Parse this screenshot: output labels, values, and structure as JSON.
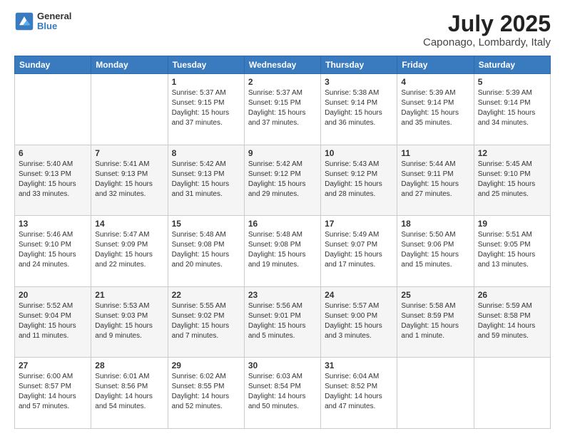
{
  "header": {
    "logo": {
      "line1": "General",
      "line2": "Blue"
    },
    "title": "July 2025",
    "subtitle": "Caponago, Lombardy, Italy"
  },
  "days_of_week": [
    "Sunday",
    "Monday",
    "Tuesday",
    "Wednesday",
    "Thursday",
    "Friday",
    "Saturday"
  ],
  "weeks": [
    [
      {
        "day": "",
        "content": ""
      },
      {
        "day": "",
        "content": ""
      },
      {
        "day": "1",
        "content": "Sunrise: 5:37 AM\nSunset: 9:15 PM\nDaylight: 15 hours\nand 37 minutes."
      },
      {
        "day": "2",
        "content": "Sunrise: 5:37 AM\nSunset: 9:15 PM\nDaylight: 15 hours\nand 37 minutes."
      },
      {
        "day": "3",
        "content": "Sunrise: 5:38 AM\nSunset: 9:14 PM\nDaylight: 15 hours\nand 36 minutes."
      },
      {
        "day": "4",
        "content": "Sunrise: 5:39 AM\nSunset: 9:14 PM\nDaylight: 15 hours\nand 35 minutes."
      },
      {
        "day": "5",
        "content": "Sunrise: 5:39 AM\nSunset: 9:14 PM\nDaylight: 15 hours\nand 34 minutes."
      }
    ],
    [
      {
        "day": "6",
        "content": "Sunrise: 5:40 AM\nSunset: 9:13 PM\nDaylight: 15 hours\nand 33 minutes."
      },
      {
        "day": "7",
        "content": "Sunrise: 5:41 AM\nSunset: 9:13 PM\nDaylight: 15 hours\nand 32 minutes."
      },
      {
        "day": "8",
        "content": "Sunrise: 5:42 AM\nSunset: 9:13 PM\nDaylight: 15 hours\nand 31 minutes."
      },
      {
        "day": "9",
        "content": "Sunrise: 5:42 AM\nSunset: 9:12 PM\nDaylight: 15 hours\nand 29 minutes."
      },
      {
        "day": "10",
        "content": "Sunrise: 5:43 AM\nSunset: 9:12 PM\nDaylight: 15 hours\nand 28 minutes."
      },
      {
        "day": "11",
        "content": "Sunrise: 5:44 AM\nSunset: 9:11 PM\nDaylight: 15 hours\nand 27 minutes."
      },
      {
        "day": "12",
        "content": "Sunrise: 5:45 AM\nSunset: 9:10 PM\nDaylight: 15 hours\nand 25 minutes."
      }
    ],
    [
      {
        "day": "13",
        "content": "Sunrise: 5:46 AM\nSunset: 9:10 PM\nDaylight: 15 hours\nand 24 minutes."
      },
      {
        "day": "14",
        "content": "Sunrise: 5:47 AM\nSunset: 9:09 PM\nDaylight: 15 hours\nand 22 minutes."
      },
      {
        "day": "15",
        "content": "Sunrise: 5:48 AM\nSunset: 9:08 PM\nDaylight: 15 hours\nand 20 minutes."
      },
      {
        "day": "16",
        "content": "Sunrise: 5:48 AM\nSunset: 9:08 PM\nDaylight: 15 hours\nand 19 minutes."
      },
      {
        "day": "17",
        "content": "Sunrise: 5:49 AM\nSunset: 9:07 PM\nDaylight: 15 hours\nand 17 minutes."
      },
      {
        "day": "18",
        "content": "Sunrise: 5:50 AM\nSunset: 9:06 PM\nDaylight: 15 hours\nand 15 minutes."
      },
      {
        "day": "19",
        "content": "Sunrise: 5:51 AM\nSunset: 9:05 PM\nDaylight: 15 hours\nand 13 minutes."
      }
    ],
    [
      {
        "day": "20",
        "content": "Sunrise: 5:52 AM\nSunset: 9:04 PM\nDaylight: 15 hours\nand 11 minutes."
      },
      {
        "day": "21",
        "content": "Sunrise: 5:53 AM\nSunset: 9:03 PM\nDaylight: 15 hours\nand 9 minutes."
      },
      {
        "day": "22",
        "content": "Sunrise: 5:55 AM\nSunset: 9:02 PM\nDaylight: 15 hours\nand 7 minutes."
      },
      {
        "day": "23",
        "content": "Sunrise: 5:56 AM\nSunset: 9:01 PM\nDaylight: 15 hours\nand 5 minutes."
      },
      {
        "day": "24",
        "content": "Sunrise: 5:57 AM\nSunset: 9:00 PM\nDaylight: 15 hours\nand 3 minutes."
      },
      {
        "day": "25",
        "content": "Sunrise: 5:58 AM\nSunset: 8:59 PM\nDaylight: 15 hours\nand 1 minute."
      },
      {
        "day": "26",
        "content": "Sunrise: 5:59 AM\nSunset: 8:58 PM\nDaylight: 14 hours\nand 59 minutes."
      }
    ],
    [
      {
        "day": "27",
        "content": "Sunrise: 6:00 AM\nSunset: 8:57 PM\nDaylight: 14 hours\nand 57 minutes."
      },
      {
        "day": "28",
        "content": "Sunrise: 6:01 AM\nSunset: 8:56 PM\nDaylight: 14 hours\nand 54 minutes."
      },
      {
        "day": "29",
        "content": "Sunrise: 6:02 AM\nSunset: 8:55 PM\nDaylight: 14 hours\nand 52 minutes."
      },
      {
        "day": "30",
        "content": "Sunrise: 6:03 AM\nSunset: 8:54 PM\nDaylight: 14 hours\nand 50 minutes."
      },
      {
        "day": "31",
        "content": "Sunrise: 6:04 AM\nSunset: 8:52 PM\nDaylight: 14 hours\nand 47 minutes."
      },
      {
        "day": "",
        "content": ""
      },
      {
        "day": "",
        "content": ""
      }
    ]
  ]
}
